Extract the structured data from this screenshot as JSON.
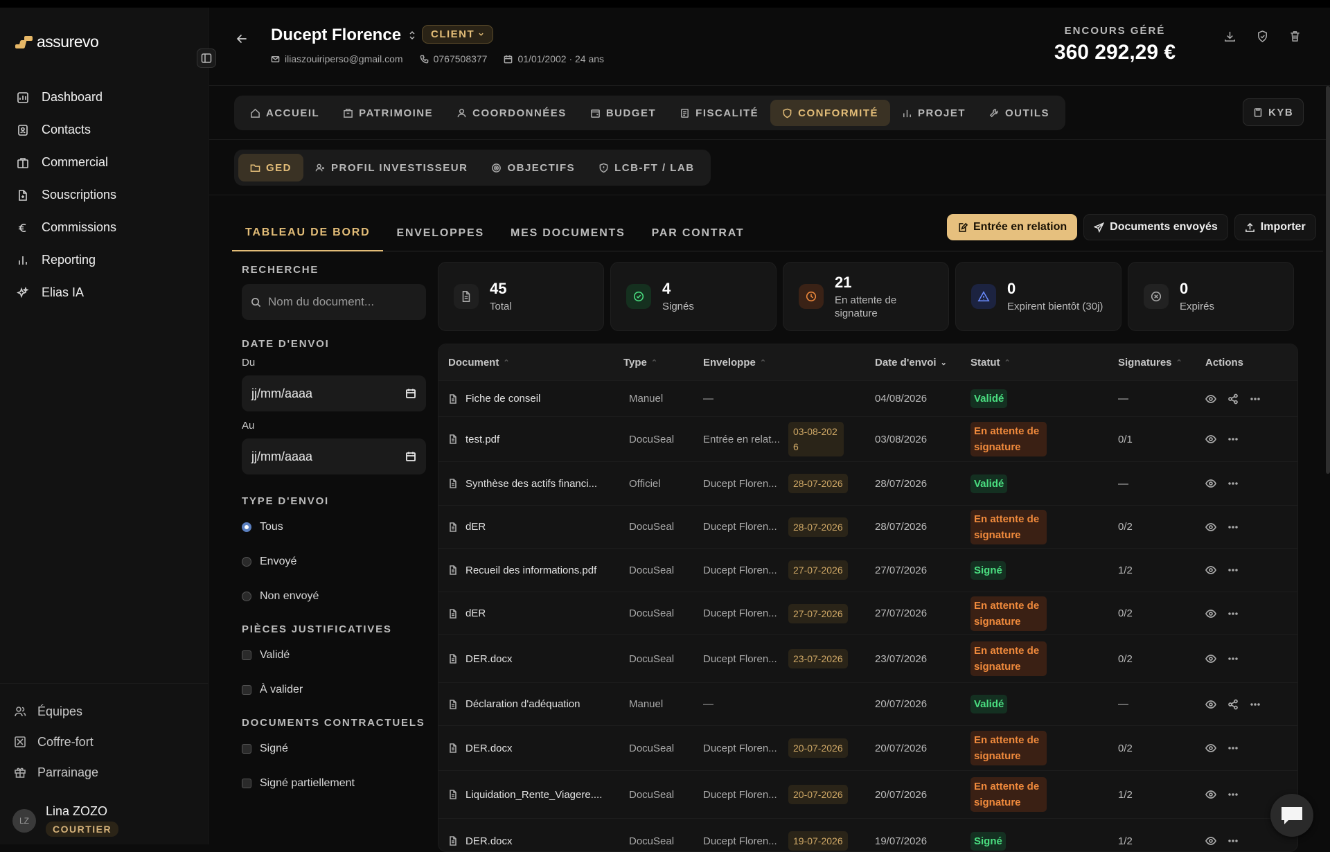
{
  "app": {
    "name": "assurevo"
  },
  "nav": {
    "items": [
      {
        "label": "Dashboard",
        "icon": "dashboard-icon"
      },
      {
        "label": "Contacts",
        "icon": "contacts-icon"
      },
      {
        "label": "Commercial",
        "icon": "commercial-icon"
      },
      {
        "label": "Souscriptions",
        "icon": "subscriptions-icon"
      },
      {
        "label": "Commissions",
        "icon": "euro-icon"
      },
      {
        "label": "Reporting",
        "icon": "chart-icon"
      },
      {
        "label": "Elias IA",
        "icon": "sparkle-icon"
      }
    ]
  },
  "sidebar_bottom": {
    "items": [
      {
        "label": "Équipes"
      },
      {
        "label": "Coffre-fort"
      },
      {
        "label": "Parrainage"
      }
    ]
  },
  "user": {
    "initials": "LZ",
    "name": "Lina ZOZO",
    "role": "COURTIER"
  },
  "client": {
    "name": "Ducept Florence",
    "badge": "CLIENT",
    "email": "iliaszouiriperso@gmail.com",
    "phone": "0767508377",
    "birth": "01/01/2002 · 24 ans"
  },
  "encours": {
    "label": "ENCOURS GÉRÉ",
    "value": "360 292,29 €"
  },
  "tabs_main": [
    {
      "label": "ACCUEIL",
      "active": false
    },
    {
      "label": "PATRIMOINE",
      "active": false
    },
    {
      "label": "COORDONNÉES",
      "active": false
    },
    {
      "label": "BUDGET",
      "active": false
    },
    {
      "label": "FISCALITÉ",
      "active": false
    },
    {
      "label": "CONFORMITÉ",
      "active": true
    },
    {
      "label": "PROJET",
      "active": false
    },
    {
      "label": "OUTILS",
      "active": false
    }
  ],
  "kyb": {
    "label": "KYB"
  },
  "tabs_sub": [
    {
      "label": "GED",
      "active": true
    },
    {
      "label": "PROFIL INVESTISSEUR",
      "active": false
    },
    {
      "label": "OBJECTIFS",
      "active": false
    },
    {
      "label": "LCB-FT / LAB",
      "active": false
    }
  ],
  "tabs_docs": [
    {
      "label": "TABLEAU DE BORD",
      "active": true
    },
    {
      "label": "ENVELOPPES",
      "active": false
    },
    {
      "label": "MES DOCUMENTS",
      "active": false
    },
    {
      "label": "PAR CONTRAT",
      "active": false
    }
  ],
  "actions": {
    "entree": "Entrée en relation",
    "envoyes": "Documents envoyés",
    "importer": "Importer"
  },
  "filters": {
    "search_label": "RECHERCHE",
    "search_placeholder": "Nom du document...",
    "date_label": "DATE D'ENVOI",
    "from_label": "Du",
    "to_label": "Au",
    "date_placeholder": "jj/mm/aaaa",
    "type_label": "TYPE D'ENVOI",
    "type_options": [
      "Tous",
      "Envoyé",
      "Non envoyé"
    ],
    "pieces_label": "PIÈCES JUSTIFICATIVES",
    "pieces_options": [
      "Validé",
      "À valider"
    ],
    "contract_label": "DOCUMENTS CONTRACTUELS",
    "contract_options": [
      "Signé",
      "Signé partiellement"
    ]
  },
  "stats": [
    {
      "value": "45",
      "label": "Total",
      "color": "#aaaaaa"
    },
    {
      "value": "4",
      "label": "Signés",
      "color": "#4ade80"
    },
    {
      "value": "21",
      "label": "En attente de signature",
      "color": "#f08a3c"
    },
    {
      "value": "0",
      "label": "Expirent bientôt (30j)",
      "color": "#6b8cff"
    },
    {
      "value": "0",
      "label": "Expirés",
      "color": "#aaaaaa"
    }
  ],
  "table": {
    "headers": [
      "Document",
      "Type",
      "Enveloppe",
      "Date d'envoi",
      "Statut",
      "Signatures",
      "Actions"
    ],
    "rows": [
      {
        "doc": "Fiche de conseil",
        "type": "Manuel",
        "env": "—",
        "edate": "",
        "date": "04/08/2026",
        "status": "Validé",
        "color": "green",
        "sig": "—",
        "share": true
      },
      {
        "doc": "test.pdf",
        "type": "DocuSeal",
        "env": "Entrée en relat...",
        "edate": "03-08-2026",
        "date": "03/08/2026",
        "status": "En attente de signature",
        "color": "orange",
        "sig": "0/1",
        "share": false
      },
      {
        "doc": "Synthèse des actifs financi...",
        "type": "Officiel",
        "env": "Ducept Floren...",
        "edate": "28-07-2026",
        "date": "28/07/2026",
        "status": "Validé",
        "color": "green",
        "sig": "—",
        "share": false
      },
      {
        "doc": "dER",
        "type": "DocuSeal",
        "env": "Ducept Floren...",
        "edate": "28-07-2026",
        "date": "28/07/2026",
        "status": "En attente de signature",
        "color": "orange",
        "sig": "0/2",
        "share": false
      },
      {
        "doc": "Recueil des informations.pdf",
        "type": "DocuSeal",
        "env": "Ducept Floren...",
        "edate": "27-07-2026",
        "date": "27/07/2026",
        "status": "Signé",
        "color": "green",
        "sig": "1/2",
        "share": false
      },
      {
        "doc": "dER",
        "type": "DocuSeal",
        "env": "Ducept Floren...",
        "edate": "27-07-2026",
        "date": "27/07/2026",
        "status": "En attente de signature",
        "color": "orange",
        "sig": "0/2",
        "share": false
      },
      {
        "doc": "DER.docx",
        "type": "DocuSeal",
        "env": "Ducept Floren...",
        "edate": "23-07-2026",
        "date": "23/07/2026",
        "status": "En attente de signature",
        "color": "orange",
        "sig": "0/2",
        "share": false
      },
      {
        "doc": "Déclaration d'adéquation",
        "type": "Manuel",
        "env": "—",
        "edate": "",
        "date": "20/07/2026",
        "status": "Validé",
        "color": "green",
        "sig": "—",
        "share": true
      },
      {
        "doc": "DER.docx",
        "type": "DocuSeal",
        "env": "Ducept Floren...",
        "edate": "20-07-2026",
        "date": "20/07/2026",
        "status": "En attente de signature",
        "color": "orange",
        "sig": "0/2",
        "share": false
      },
      {
        "doc": "Liquidation_Rente_Viagere....",
        "type": "DocuSeal",
        "env": "Ducept Floren...",
        "edate": "20-07-2026",
        "date": "20/07/2026",
        "status": "En attente de signature",
        "color": "orange",
        "sig": "1/2",
        "share": false
      },
      {
        "doc": "DER.docx",
        "type": "DocuSeal",
        "env": "Ducept Floren...",
        "edate": "19-07-2026",
        "date": "19/07/2026",
        "status": "Signé",
        "color": "green",
        "sig": "1/2",
        "share": false
      }
    ]
  }
}
